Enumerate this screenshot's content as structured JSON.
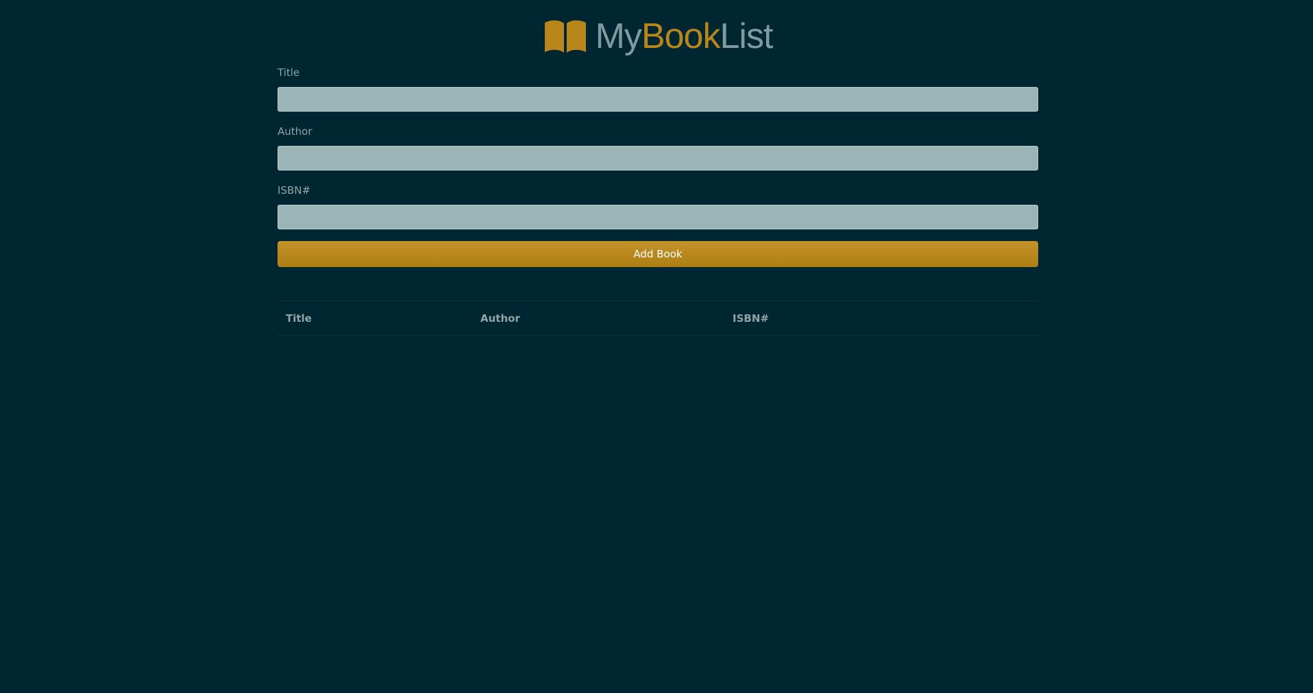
{
  "brand": {
    "part_my": "My",
    "part_book": "Book",
    "part_list": "List",
    "icon": "open-book-icon",
    "accent_color": "#b8861b",
    "muted_color": "#7f9aa0"
  },
  "form": {
    "title_label": "Title",
    "title_value": "",
    "author_label": "Author",
    "author_value": "",
    "isbn_label": "ISBN#",
    "isbn_value": "",
    "submit_label": "Add Book"
  },
  "table": {
    "headers": [
      "Title",
      "Author",
      "ISBN#"
    ],
    "rows": []
  },
  "colors": {
    "background": "#002631",
    "input_background": "#9bb4b5",
    "button": "#b8861b"
  }
}
